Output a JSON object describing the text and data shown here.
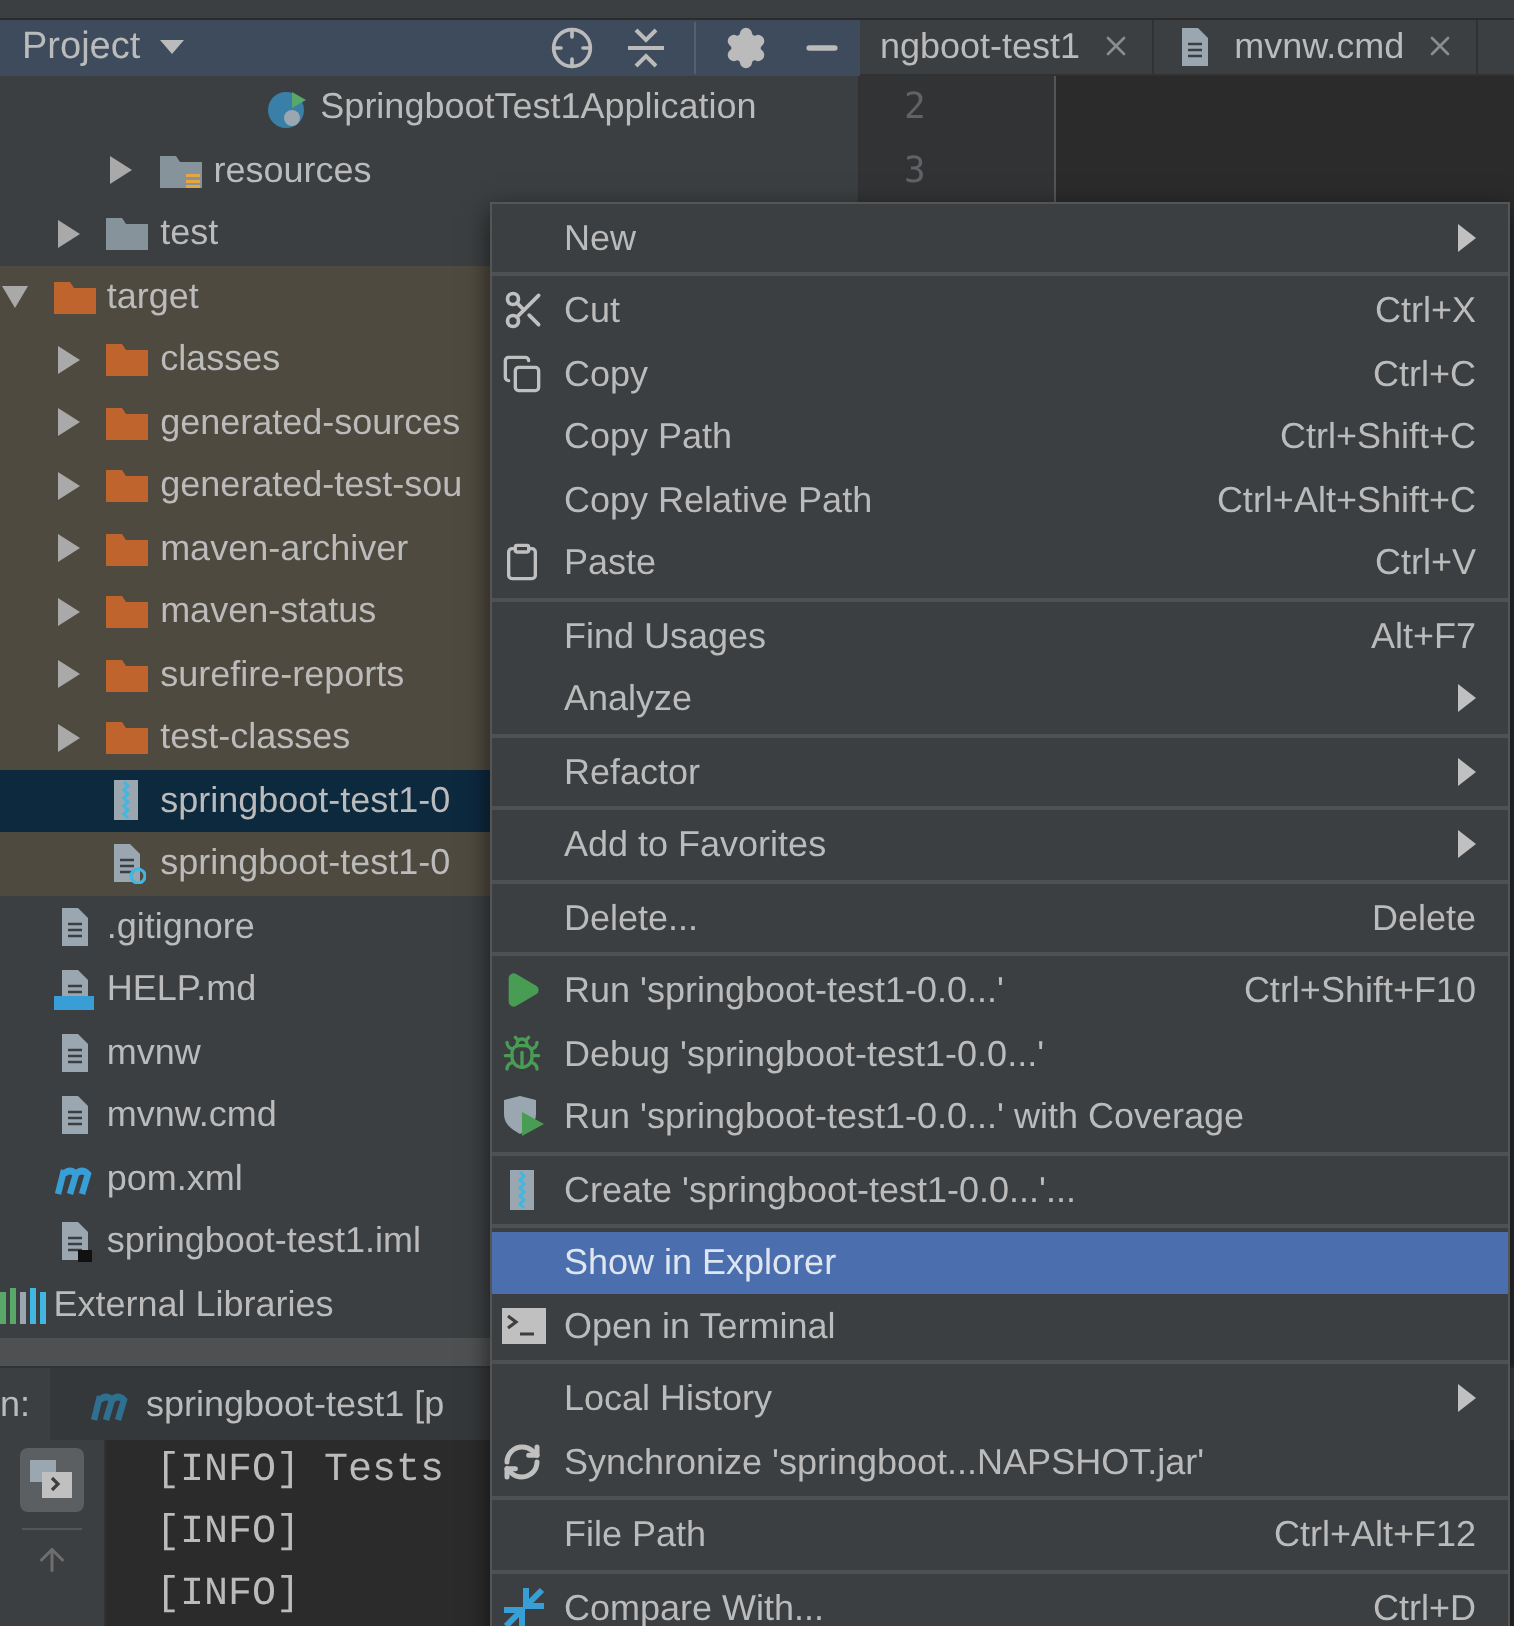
{
  "project_panel": {
    "title": "Project",
    "tree": [
      {
        "children": [
          {
            "children": [
              {
                "children": [
                  {
                    "children": [
                      {
                        "children": [
                          {
                            "label": "SpringbootTest1Application",
                            "kind": "class",
                            "selected": false,
                            "excluded": false
                          }
                        ]
                      }
                    ]
                  },
                  {
                    "label": "resources",
                    "kind": "resources",
                    "expanded": false,
                    "selected": false,
                    "excluded": false
                  }
                ]
              },
              {
                "label": "test",
                "kind": "folder",
                "expanded": false,
                "selected": false,
                "excluded": false
              }
            ]
          },
          {
            "label": "target",
            "kind": "excluded_folder",
            "expanded": true,
            "selected": false,
            "excluded": true,
            "children": [
              {
                "label": "classes",
                "kind": "excluded_folder",
                "expanded": false,
                "selected": false,
                "excluded": true
              },
              {
                "label": "generated-sources",
                "kind": "excluded_folder",
                "expanded": false,
                "selected": false,
                "excluded": true
              },
              {
                "label": "generated-test-sou",
                "kind": "excluded_folder",
                "expanded": false,
                "selected": false,
                "excluded": true
              },
              {
                "label": "maven-archiver",
                "kind": "excluded_folder",
                "expanded": false,
                "selected": false,
                "excluded": true
              },
              {
                "label": "maven-status",
                "kind": "excluded_folder",
                "expanded": false,
                "selected": false,
                "excluded": true
              },
              {
                "label": "surefire-reports",
                "kind": "excluded_folder",
                "expanded": false,
                "selected": false,
                "excluded": true
              },
              {
                "label": "test-classes",
                "kind": "excluded_folder",
                "expanded": false,
                "selected": false,
                "excluded": true
              },
              {
                "label": "springboot-test1-0",
                "kind": "jar",
                "selected": true
              },
              {
                "label": "springboot-test1-0",
                "kind": "unknown",
                "selected": false,
                "excluded": true
              }
            ]
          },
          {
            "label": ".gitignore",
            "kind": "text",
            "selected": false,
            "excluded": false
          },
          {
            "label": "HELP.md",
            "kind": "markdown",
            "selected": false,
            "excluded": false
          },
          {
            "label": "mvnw",
            "kind": "text",
            "selected": false,
            "excluded": false
          },
          {
            "label": "mvnw.cmd",
            "kind": "text",
            "selected": false,
            "excluded": false
          },
          {
            "label": "pom.xml",
            "kind": "maven",
            "selected": false,
            "excluded": false
          },
          {
            "label": "springboot-test1.iml",
            "kind": "iml",
            "selected": false,
            "excluded": false
          }
        ]
      },
      {
        "label": "External Libraries",
        "kind": "libraries",
        "selected": false,
        "excluded": false
      }
    ]
  },
  "editor_tabs": [
    {
      "label": "ngboot-test1",
      "selected": false
    },
    {
      "label": "mvnw.cmd",
      "selected": false
    }
  ],
  "editor": {
    "line_numbers": [
      "2",
      "3"
    ]
  },
  "context_menu": {
    "items": [
      {
        "kind": "item",
        "label": "New",
        "submenu": true,
        "selected": false
      },
      {
        "kind": "separator"
      },
      {
        "kind": "scissors",
        "label": "Cut",
        "shortcut": "Ctrl+X",
        "submenu": false,
        "selected": false
      },
      {
        "kind": "copy",
        "label": "Copy",
        "shortcut": "Ctrl+C",
        "submenu": false,
        "selected": false
      },
      {
        "kind": "item",
        "label": "Copy Path",
        "shortcut": "Ctrl+Shift+C",
        "submenu": false,
        "selected": false
      },
      {
        "kind": "item",
        "label": "Copy Relative Path",
        "shortcut": "Ctrl+Alt+Shift+C",
        "submenu": false,
        "selected": false
      },
      {
        "kind": "clipboard",
        "label": "Paste",
        "shortcut": "Ctrl+V",
        "submenu": false,
        "selected": false
      },
      {
        "kind": "separator"
      },
      {
        "kind": "item",
        "label": "Find Usages",
        "shortcut": "Alt+F7",
        "submenu": false,
        "selected": false
      },
      {
        "kind": "item",
        "label": "Analyze",
        "submenu": true,
        "selected": false
      },
      {
        "kind": "separator"
      },
      {
        "kind": "item",
        "label": "Refactor",
        "submenu": true,
        "selected": false
      },
      {
        "kind": "separator"
      },
      {
        "kind": "item",
        "label": "Add to Favorites",
        "submenu": true,
        "selected": false
      },
      {
        "kind": "separator"
      },
      {
        "kind": "item",
        "label": "Delete...",
        "shortcut": "Delete",
        "submenu": false,
        "selected": false
      },
      {
        "kind": "separator"
      },
      {
        "kind": "play",
        "label": "Run 'springboot-test1-0.0...'",
        "shortcut": "Ctrl+Shift+F10",
        "submenu": false,
        "selected": false
      },
      {
        "kind": "bug",
        "label": "Debug 'springboot-test1-0.0...'",
        "submenu": false,
        "selected": false
      },
      {
        "kind": "coverage",
        "label": "Run 'springboot-test1-0.0...' with Coverage",
        "submenu": false,
        "selected": false
      },
      {
        "kind": "separator"
      },
      {
        "kind": "archive",
        "label": "Create 'springboot-test1-0.0...'...",
        "submenu": false,
        "selected": false
      },
      {
        "kind": "separator"
      },
      {
        "kind": "item",
        "label": "Show in Explorer",
        "submenu": false,
        "selected": true
      },
      {
        "kind": "terminal",
        "label": "Open in Terminal",
        "submenu": false,
        "selected": false
      },
      {
        "kind": "separator"
      },
      {
        "kind": "item",
        "label": "Local History",
        "submenu": true,
        "selected": false
      },
      {
        "kind": "sync",
        "label": "Synchronize 'springboot...NAPSHOT.jar'",
        "submenu": false,
        "selected": false
      },
      {
        "kind": "separator"
      },
      {
        "kind": "item",
        "label": "File Path",
        "shortcut": "Ctrl+Alt+F12",
        "submenu": false,
        "selected": false
      },
      {
        "kind": "separator"
      },
      {
        "kind": "compare",
        "label": "Compare With...",
        "shortcut": "Ctrl+D",
        "submenu": false,
        "selected": false
      }
    ]
  },
  "run_panel": {
    "label": "n:",
    "tab": "springboot-test1 [p",
    "console_lines": [
      "[INFO] Tests",
      "[INFO]",
      "[INFO]"
    ]
  }
}
